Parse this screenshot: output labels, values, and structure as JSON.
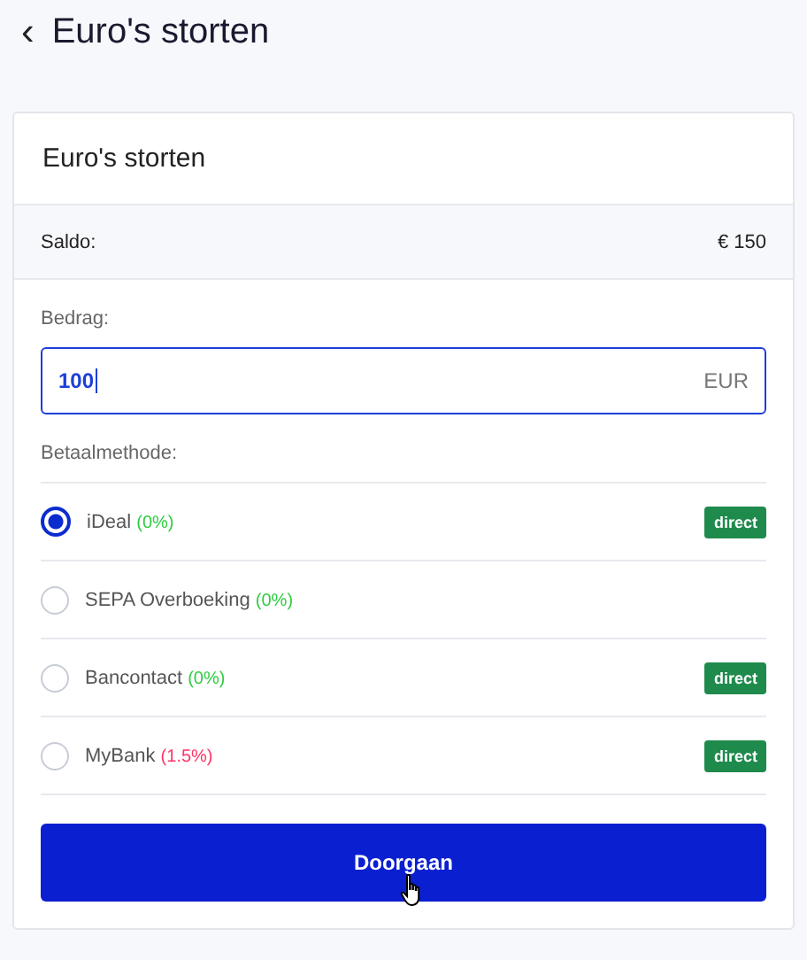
{
  "header": {
    "back": "‹",
    "title": "Euro's storten"
  },
  "card": {
    "title": "Euro's storten",
    "balance_label": "Saldo:",
    "balance_value": "€ 150",
    "amount": {
      "label": "Bedrag:",
      "value": "100",
      "unit": "EUR"
    },
    "methods_label": "Betaalmethode:",
    "methods": [
      {
        "name": "iDeal",
        "fee": "(0%)",
        "color": "#2ecc40",
        "selected": true,
        "badge": "direct"
      },
      {
        "name": "SEPA Overboeking",
        "fee": "(0%)",
        "color": "#2ecc40",
        "selected": false
      },
      {
        "name": "Bancontact",
        "fee": "(0%)",
        "color": "#2ecc40",
        "selected": false,
        "badge": "direct"
      },
      {
        "name": "MyBank",
        "fee": "(1.5%)",
        "color": "#ff3366",
        "selected": false,
        "badge": "direct"
      }
    ],
    "button": "Doorgaan"
  }
}
